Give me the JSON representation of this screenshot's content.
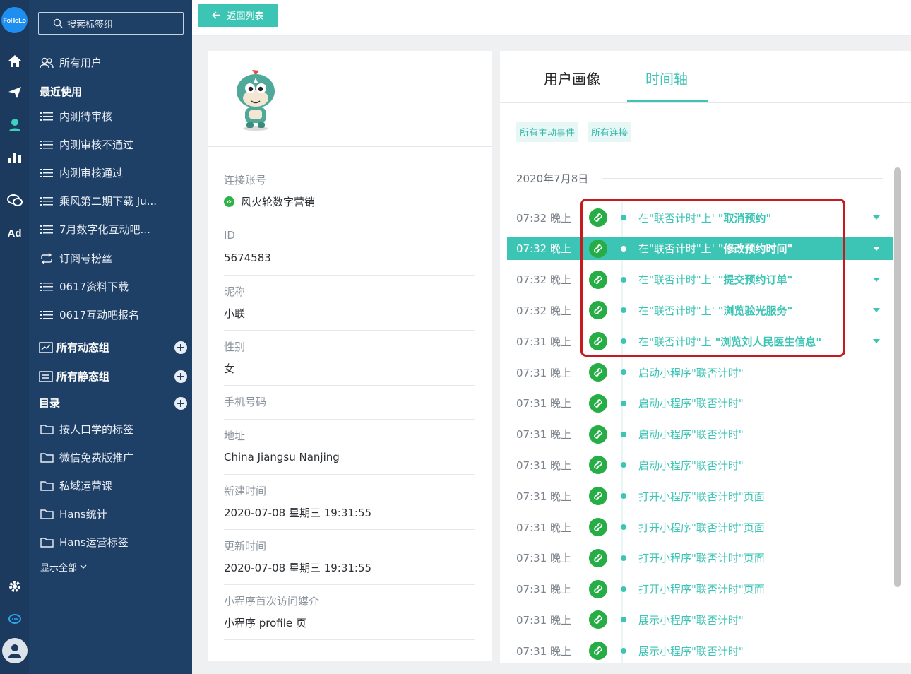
{
  "app": {
    "logo_text": "FoHoLo"
  },
  "rail": {
    "icons": [
      "home-icon",
      "send-icon",
      "user-icon",
      "bar-chart-icon",
      "chat-icon"
    ],
    "ad_label": "Ad",
    "bottom_icons": [
      "gear-icon",
      "message-icon",
      "account-avatar"
    ]
  },
  "sidebar": {
    "search_placeholder": "搜索标签组",
    "all_users": "所有用户",
    "recent_heading": "最近使用",
    "recent_items": [
      "内测待审核",
      "内测审核不通过",
      "内测审核通过",
      "乘风第二期下载 Ju...",
      "7月数字化互动吧...",
      "订阅号粉丝",
      "0617资料下载",
      "0617互动吧报名"
    ],
    "dynamic_groups": "所有动态组",
    "static_groups": "所有静态组",
    "catalog": "目录",
    "folders": [
      "按人口学的标签",
      "微信免费版推广",
      "私域运营课",
      "Hans统计",
      "Hans运营标签"
    ],
    "show_all": "显示全部"
  },
  "topbar": {
    "back_label": "返回列表"
  },
  "profile": {
    "fields": [
      {
        "label": "连接账号",
        "value": "风火轮数字营销"
      },
      {
        "label": "ID",
        "value": "5674583"
      },
      {
        "label": "昵称",
        "value": "小联"
      },
      {
        "label": "性别",
        "value": "女"
      },
      {
        "label": "手机号码",
        "value": ""
      },
      {
        "label": "地址",
        "value": "China Jiangsu Nanjing"
      },
      {
        "label": "新建时间",
        "value": "2020-07-08 星期三 19:31:55"
      },
      {
        "label": "更新时间",
        "value": "2020-07-08 星期三 19:31:55"
      },
      {
        "label": "小程序首次访问媒介",
        "value": "小程序 profile 页"
      }
    ]
  },
  "timeline": {
    "tabs": [
      "用户画像",
      "时间轴"
    ],
    "active_tab": "时间轴",
    "filters": [
      "所有主动事件",
      "所有连接"
    ],
    "date": "2020年7月8日",
    "events": [
      {
        "time": "07:32 晚上",
        "prefix": "在\"联否计时\"上'",
        "action": "\"取消预约\"",
        "expandable": true,
        "highlighted": false
      },
      {
        "time": "07:32 晚上",
        "prefix": "在\"联否计时\"上'",
        "action": "\"修改预约时间\"",
        "expandable": true,
        "highlighted": true
      },
      {
        "time": "07:32 晚上",
        "prefix": "在\"联否计时\"上'",
        "action": "\"提交预约订单\"",
        "expandable": true,
        "highlighted": false
      },
      {
        "time": "07:32 晚上",
        "prefix": "在\"联否计时\"上'",
        "action": "\"浏览验光服务\"",
        "expandable": true,
        "highlighted": false
      },
      {
        "time": "07:31 晚上",
        "prefix": "在\"联否计时\"上",
        "action": "\"浏览刘人民医生信息\"",
        "expandable": true,
        "highlighted": false
      },
      {
        "time": "07:31 晚上",
        "prefix": "启动小程序\"联否计时\"",
        "action": "",
        "expandable": false,
        "highlighted": false
      },
      {
        "time": "07:31 晚上",
        "prefix": "启动小程序\"联否计时\"",
        "action": "",
        "expandable": false,
        "highlighted": false
      },
      {
        "time": "07:31 晚上",
        "prefix": "启动小程序\"联否计时\"",
        "action": "",
        "expandable": false,
        "highlighted": false
      },
      {
        "time": "07:31 晚上",
        "prefix": "启动小程序\"联否计时\"",
        "action": "",
        "expandable": false,
        "highlighted": false
      },
      {
        "time": "07:31 晚上",
        "prefix": "打开小程序\"联否计时\"页面",
        "action": "",
        "expandable": false,
        "highlighted": false
      },
      {
        "time": "07:31 晚上",
        "prefix": "打开小程序\"联否计时\"页面",
        "action": "",
        "expandable": false,
        "highlighted": false
      },
      {
        "time": "07:31 晚上",
        "prefix": "打开小程序\"联否计时\"页面",
        "action": "",
        "expandable": false,
        "highlighted": false
      },
      {
        "time": "07:31 晚上",
        "prefix": "打开小程序\"联否计时\"页面",
        "action": "",
        "expandable": false,
        "highlighted": false
      },
      {
        "time": "07:31 晚上",
        "prefix": "展示小程序\"联否计时\"",
        "action": "",
        "expandable": false,
        "highlighted": false
      },
      {
        "time": "07:31 晚上",
        "prefix": "展示小程序\"联否计时\"",
        "action": "",
        "expandable": false,
        "highlighted": false
      }
    ]
  },
  "colors": {
    "accent": "#3cc4b4",
    "sidebar_bg": "#1e3f66",
    "rail_bg": "#1c3a5e",
    "mini_program_green": "#26ad45",
    "annotation_red": "#c8191f"
  }
}
